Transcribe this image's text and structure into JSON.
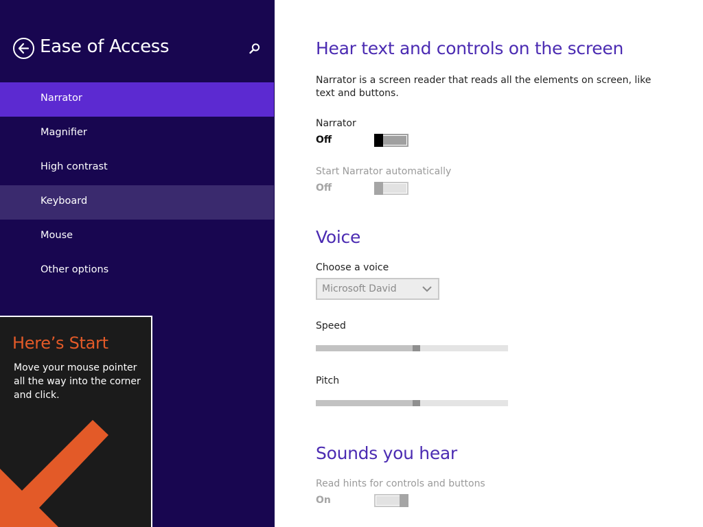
{
  "sidebar": {
    "title": "Ease of Access",
    "back_icon": "back-arrow-icon",
    "search_icon": "search-icon",
    "colors": {
      "background": "#180650",
      "selected": "#5c2ad1",
      "hover": "#3a2a6e"
    },
    "items": [
      {
        "label": "Narrator",
        "state": "selected"
      },
      {
        "label": "Magnifier",
        "state": "normal"
      },
      {
        "label": "High contrast",
        "state": "normal"
      },
      {
        "label": "Keyboard",
        "state": "hover"
      },
      {
        "label": "Mouse",
        "state": "normal"
      },
      {
        "label": "Other options",
        "state": "normal"
      }
    ]
  },
  "tip": {
    "title": "Here’s Start",
    "body": "Move your mouse pointer all the way into the corner and click.",
    "accent_color": "#e35a28",
    "arrow_icon": "arrow-down-left-icon"
  },
  "content": {
    "heading_color": "#4b2bb2",
    "hear": {
      "heading": "Hear text and controls on the screen",
      "description": "Narrator is a screen reader that reads all the elements on screen, like text and buttons.",
      "narrator": {
        "label": "Narrator",
        "state_text": "Off",
        "on": false,
        "enabled": true
      },
      "auto_start": {
        "label": "Start Narrator automatically",
        "state_text": "Off",
        "on": false,
        "enabled": false
      }
    },
    "voice": {
      "heading": "Voice",
      "choose_label": "Choose a voice",
      "selected_voice": "Microsoft David",
      "dropdown_icon": "chevron-down-icon",
      "speed": {
        "label": "Speed",
        "value": 0.5
      },
      "pitch": {
        "label": "Pitch",
        "value": 0.5
      }
    },
    "sounds": {
      "heading": "Sounds you hear",
      "hints": {
        "label": "Read hints for controls and buttons",
        "state_text": "On",
        "on": true,
        "enabled": false
      }
    }
  }
}
